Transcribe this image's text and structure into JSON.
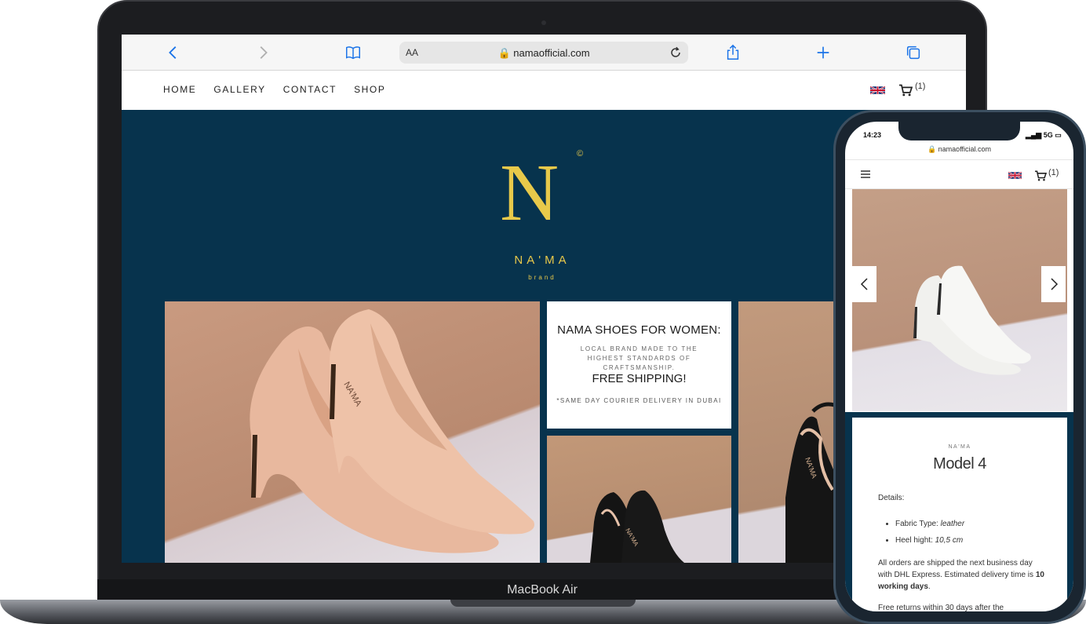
{
  "laptop": {
    "bezel_label": "MacBook Air",
    "browser": {
      "aa_label": "AA",
      "url": "namaofficial.com"
    },
    "nav": {
      "items": [
        {
          "label": "HOME"
        },
        {
          "label": "GALLERY"
        },
        {
          "label": "CONTACT"
        },
        {
          "label": "SHOP"
        }
      ],
      "cart_count": "(1)"
    },
    "logo": {
      "letter": "N",
      "copyright": "©",
      "name": "NA'MA",
      "tagline": "brand"
    },
    "promo": {
      "title": "NAMA SHOES FOR WOMEN:",
      "subtitle": "LOCAL BRAND MADE TO THE HIGHEST STANDARDS OF CRAFTSMANSHIP.",
      "shipping": "FREE SHIPPING!",
      "note": "*SAME DAY COURIER DELIVERY IN DUBAI"
    },
    "shoe_brand_marks": [
      "NA'MA",
      "NA'MA",
      "NA'MA"
    ]
  },
  "phone": {
    "time": "14:23",
    "network": "5G",
    "url": "namaofficial.com",
    "cart_count": "(1)",
    "product": {
      "brand": "NA'MA",
      "model": "Model 4",
      "details_label": "Details:",
      "fabric_label": "Fabric Type:",
      "fabric_value": "leather",
      "heel_label": "Heel hight:",
      "heel_value": "10,5 cm",
      "shipping_text": "All orders are shipped the next business day with DHL Express. Estimated delivery time is",
      "shipping_bold": "10 working days",
      "shipping_end": ".",
      "returns_text": "Free returns within 30 days after the"
    }
  },
  "colors": {
    "navy": "#07334d",
    "gold": "#e8c94a",
    "nude_shoe": "#e7b79d",
    "black_shoe": "#141414",
    "white_shoe": "#f4f4f2"
  }
}
